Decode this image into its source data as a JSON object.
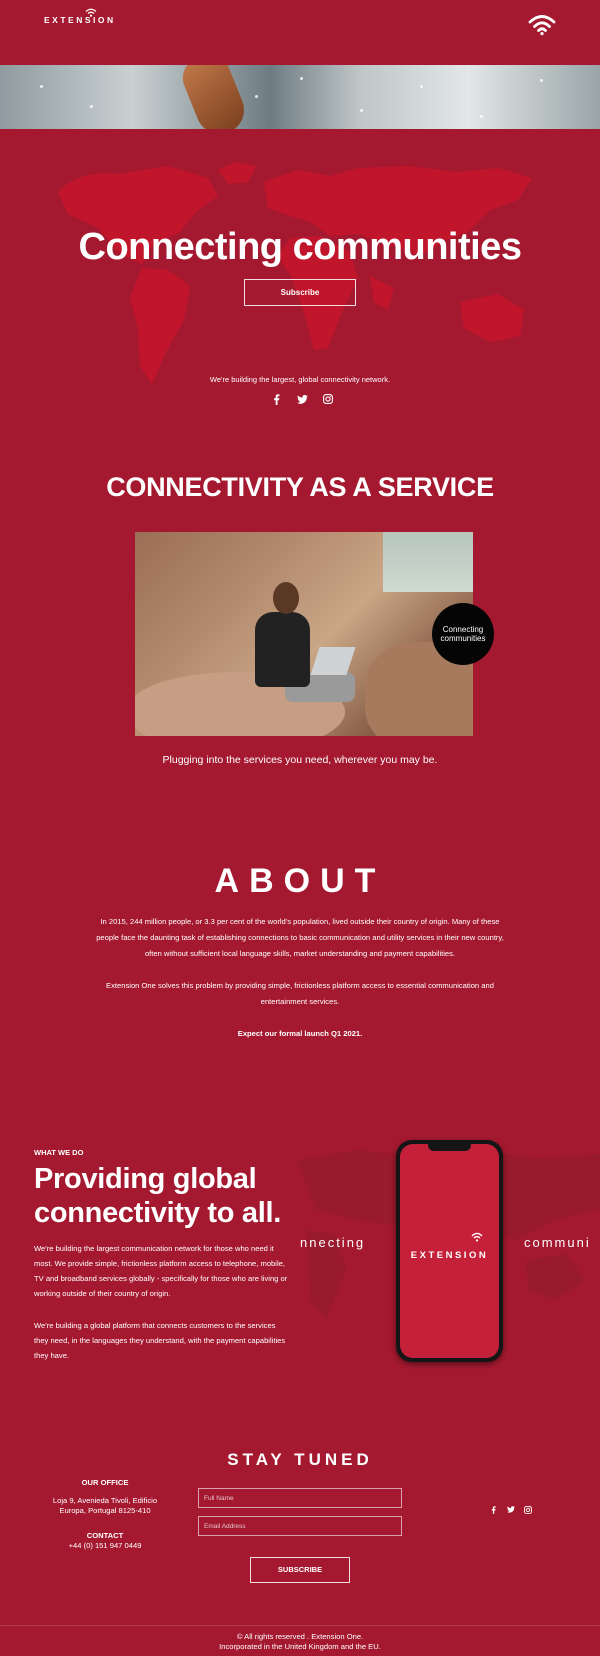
{
  "header": {
    "logo_text": "EXTENSION"
  },
  "hero": {
    "title": "Connecting communities",
    "subscribe_label": "Subscribe",
    "tagline": "We're building the largest, global connectivity network."
  },
  "social_icons": [
    "facebook-icon",
    "twitter-icon",
    "instagram-icon"
  ],
  "service": {
    "title": "CONNECTIVITY AS A SERVICE",
    "badge": "Connecting communities",
    "caption": "Plugging into the services you need, wherever you may be."
  },
  "about": {
    "title": "ABOUT",
    "p1": "In 2015, 244 million people, or 3.3 per cent of the world's population, lived outside their country of origin. Many of these people face the daunting task of establishing connections to basic communication and utility services in their new country, often without sufficient local language skills, market understanding and payment capabilities.",
    "p2": "Extension One solves this problem by providing simple, frictionless platform access to essential communication and entertainment services.",
    "p3": "Expect our formal launch Q1 2021."
  },
  "what_we_do": {
    "label": "WHAT WE DO",
    "title": "Providing global connectivity to all.",
    "p1": "We're building the largest communication network for those who need it most. We provide simple, frictionless platform access to telephone, mobile, TV and broadband services globally - specifically for those who are living or working outside of their country of origin.",
    "p2": "We're building a global platform that connects customers to the services they need, in the languages they understand, with the payment capabilities they have.",
    "marquee_left": "nnecting",
    "marquee_right": "communi",
    "phone_text": "EXTENSION"
  },
  "stay_tuned": {
    "title": "STAY TUNED",
    "office_heading": "OUR OFFICE",
    "office_address": "Loja 9, Avenieda Tivoli, Edificio Europa, Portugal 8125-410",
    "contact_heading": "CONTACT",
    "contact_phone": "+44 (0) 151 947 0449",
    "name_placeholder": "Full Name",
    "email_placeholder": "Email Address",
    "subscribe_label": "SUBSCRIBE"
  },
  "footer": {
    "line1": "© All rights reserved . Extension One.",
    "line2": "Incorporated in the United Kingdom and the EU."
  },
  "colors": {
    "background": "#a41930",
    "map": "#c1152b",
    "badge": "#050505"
  }
}
